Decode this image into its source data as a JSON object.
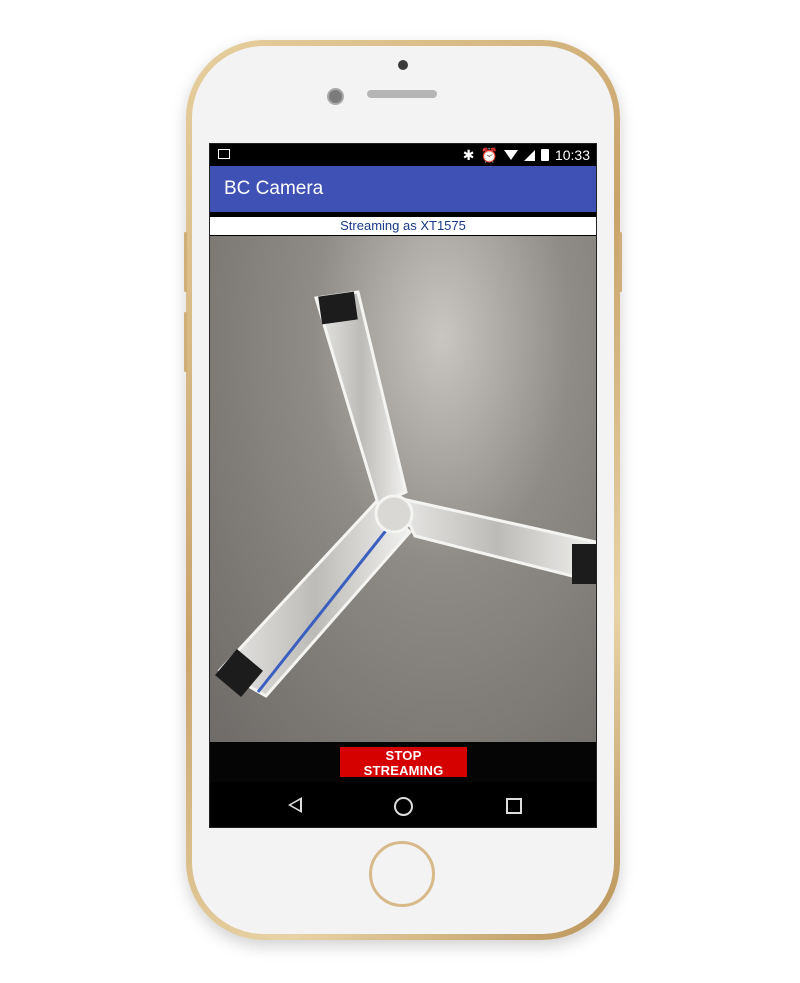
{
  "status_bar": {
    "time": "10:33",
    "icons": [
      "image-icon",
      "bluetooth-icon",
      "alarm-icon",
      "wifi-icon",
      "signal-icon",
      "battery-icon"
    ]
  },
  "app_bar": {
    "title": "BC Camera",
    "color": "#3f51b5"
  },
  "stream_status": "Streaming as XT1575",
  "controls": {
    "stop_button_label": "STOP STREAMING",
    "stop_button_color": "#d50000"
  },
  "nav_bar": {
    "icons": [
      "back-icon",
      "home-icon",
      "recents-icon"
    ]
  },
  "colors": {
    "phone_frame": "#d4b27c",
    "subtitle_text": "#1a3a8a"
  }
}
